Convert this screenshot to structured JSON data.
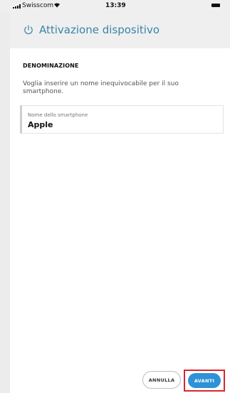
{
  "status_bar": {
    "carrier": "Swisscom",
    "time": "13:39"
  },
  "header": {
    "title": "Attivazione dispositivo",
    "icon": "power-icon"
  },
  "section": {
    "title": "DENOMINAZIONE",
    "description": "Voglia inserire un nome inequivocabile per il suo smartphone."
  },
  "field": {
    "label": "Nome dello smartphone",
    "value": "Apple"
  },
  "buttons": {
    "cancel": "ANNULLA",
    "next": "AVANTI"
  },
  "colors": {
    "accent": "#3a85a8",
    "primary_button": "#2f92d6",
    "highlight": "#d8262e"
  }
}
